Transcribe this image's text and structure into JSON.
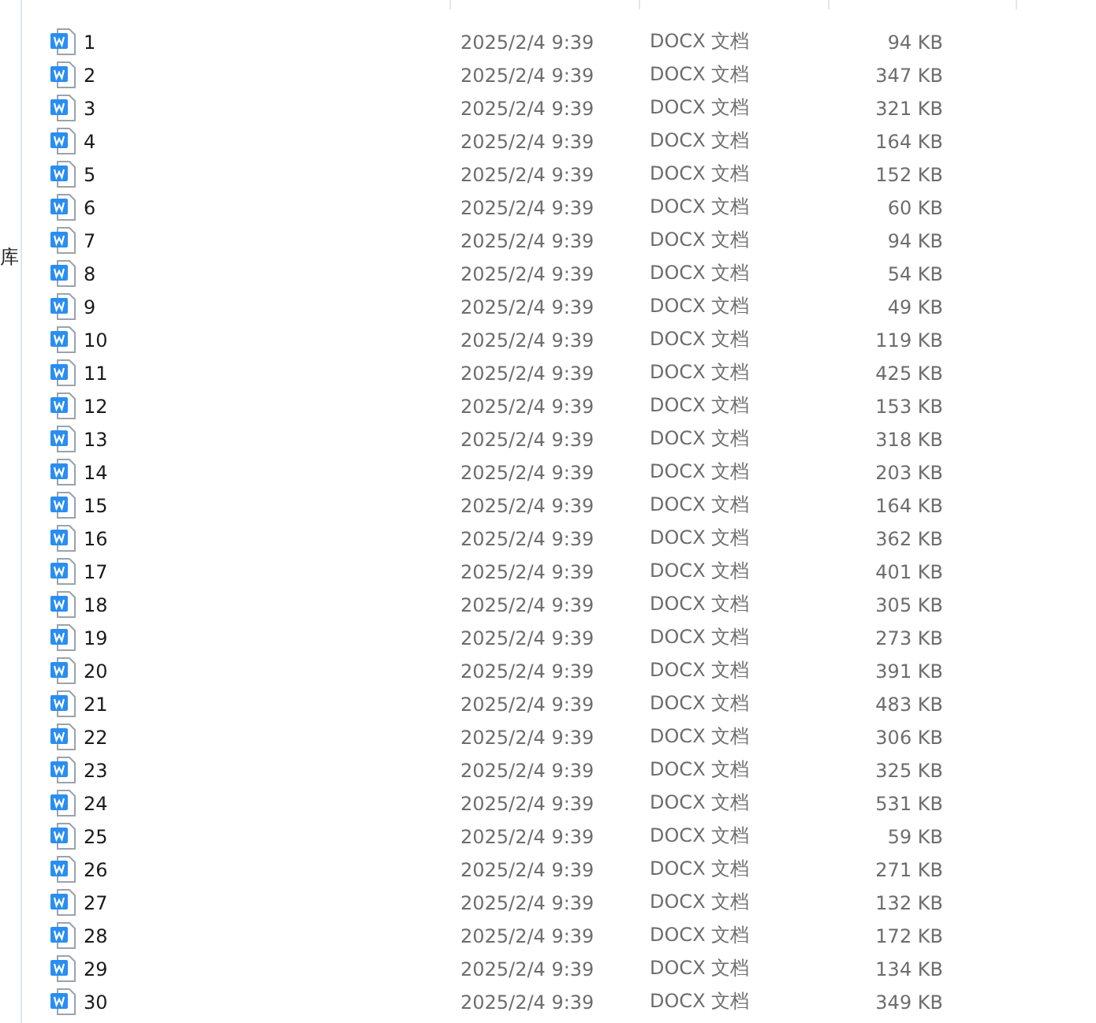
{
  "sidebar": {
    "items": [
      {
        "label": "库",
        "selected": false
      }
    ]
  },
  "rows": [
    {
      "name": "1",
      "date": "2025/2/4 9:39",
      "type": "DOCX 文档",
      "size": "94 KB"
    },
    {
      "name": "2",
      "date": "2025/2/4 9:39",
      "type": "DOCX 文档",
      "size": "347 KB"
    },
    {
      "name": "3",
      "date": "2025/2/4 9:39",
      "type": "DOCX 文档",
      "size": "321 KB"
    },
    {
      "name": "4",
      "date": "2025/2/4 9:39",
      "type": "DOCX 文档",
      "size": "164 KB"
    },
    {
      "name": "5",
      "date": "2025/2/4 9:39",
      "type": "DOCX 文档",
      "size": "152 KB"
    },
    {
      "name": "6",
      "date": "2025/2/4 9:39",
      "type": "DOCX 文档",
      "size": "60 KB"
    },
    {
      "name": "7",
      "date": "2025/2/4 9:39",
      "type": "DOCX 文档",
      "size": "94 KB"
    },
    {
      "name": "8",
      "date": "2025/2/4 9:39",
      "type": "DOCX 文档",
      "size": "54 KB"
    },
    {
      "name": "9",
      "date": "2025/2/4 9:39",
      "type": "DOCX 文档",
      "size": "49 KB"
    },
    {
      "name": "10",
      "date": "2025/2/4 9:39",
      "type": "DOCX 文档",
      "size": "119 KB"
    },
    {
      "name": "11",
      "date": "2025/2/4 9:39",
      "type": "DOCX 文档",
      "size": "425 KB"
    },
    {
      "name": "12",
      "date": "2025/2/4 9:39",
      "type": "DOCX 文档",
      "size": "153 KB"
    },
    {
      "name": "13",
      "date": "2025/2/4 9:39",
      "type": "DOCX 文档",
      "size": "318 KB"
    },
    {
      "name": "14",
      "date": "2025/2/4 9:39",
      "type": "DOCX 文档",
      "size": "203 KB"
    },
    {
      "name": "15",
      "date": "2025/2/4 9:39",
      "type": "DOCX 文档",
      "size": "164 KB"
    },
    {
      "name": "16",
      "date": "2025/2/4 9:39",
      "type": "DOCX 文档",
      "size": "362 KB"
    },
    {
      "name": "17",
      "date": "2025/2/4 9:39",
      "type": "DOCX 文档",
      "size": "401 KB"
    },
    {
      "name": "18",
      "date": "2025/2/4 9:39",
      "type": "DOCX 文档",
      "size": "305 KB"
    },
    {
      "name": "19",
      "date": "2025/2/4 9:39",
      "type": "DOCX 文档",
      "size": "273 KB"
    },
    {
      "name": "20",
      "date": "2025/2/4 9:39",
      "type": "DOCX 文档",
      "size": "391 KB"
    },
    {
      "name": "21",
      "date": "2025/2/4 9:39",
      "type": "DOCX 文档",
      "size": "483 KB"
    },
    {
      "name": "22",
      "date": "2025/2/4 9:39",
      "type": "DOCX 文档",
      "size": "306 KB"
    },
    {
      "name": "23",
      "date": "2025/2/4 9:39",
      "type": "DOCX 文档",
      "size": "325 KB"
    },
    {
      "name": "24",
      "date": "2025/2/4 9:39",
      "type": "DOCX 文档",
      "size": "531 KB"
    },
    {
      "name": "25",
      "date": "2025/2/4 9:39",
      "type": "DOCX 文档",
      "size": "59 KB"
    },
    {
      "name": "26",
      "date": "2025/2/4 9:39",
      "type": "DOCX 文档",
      "size": "271 KB"
    },
    {
      "name": "27",
      "date": "2025/2/4 9:39",
      "type": "DOCX 文档",
      "size": "132 KB"
    },
    {
      "name": "28",
      "date": "2025/2/4 9:39",
      "type": "DOCX 文档",
      "size": "172 KB"
    },
    {
      "name": "29",
      "date": "2025/2/4 9:39",
      "type": "DOCX 文档",
      "size": "134 KB"
    },
    {
      "name": "30",
      "date": "2025/2/4 9:39",
      "type": "DOCX 文档",
      "size": "349 KB"
    }
  ]
}
